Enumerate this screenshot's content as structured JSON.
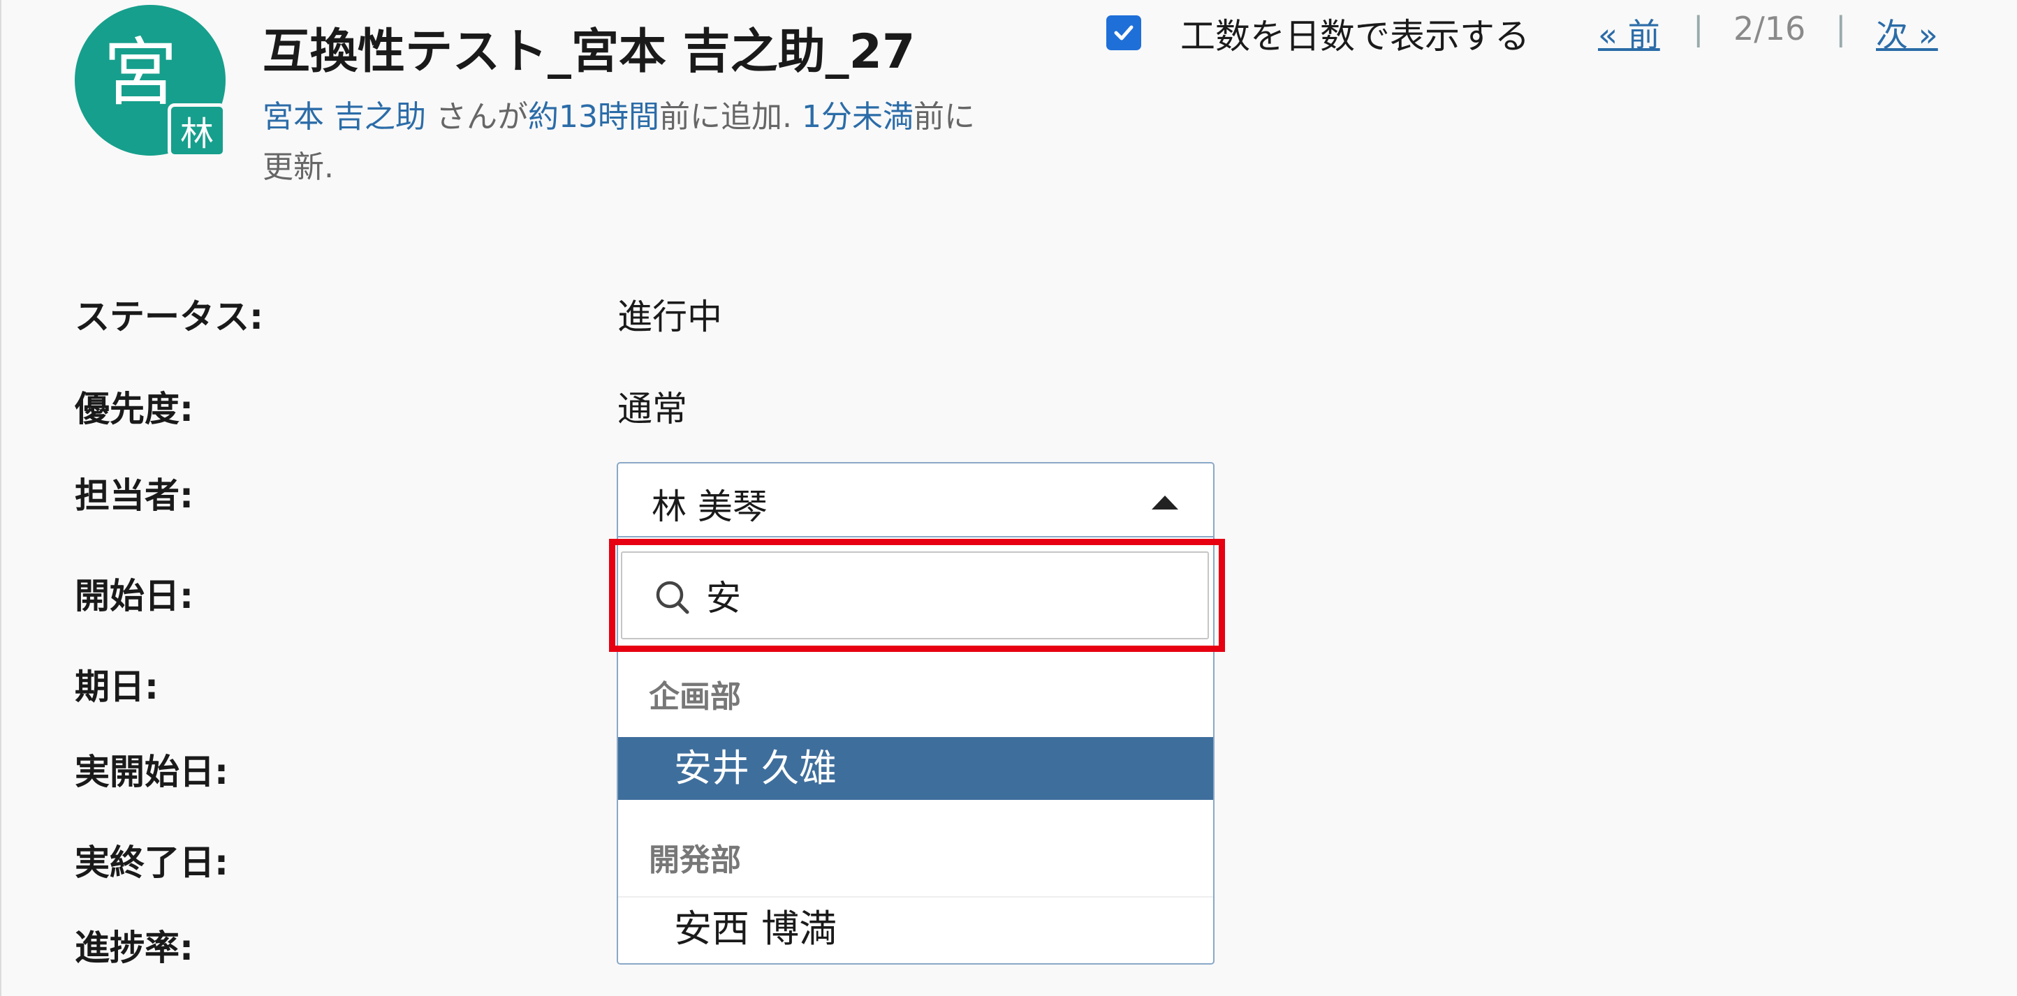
{
  "header": {
    "avatar_char": "宮",
    "avatar_badge": "林",
    "title": "互換性テスト_宮本 吉之助_27",
    "author_link": "宮本 吉之助",
    "text_san_ga": " さんが",
    "added_link": "約13時間",
    "text_added": "前に追加. ",
    "updated_link": "1分未満",
    "text_updated_a": "前に",
    "text_updated_b": "更新."
  },
  "options_bar": {
    "show_days_checked": true,
    "show_days_label": "工数を日数で表示する",
    "prev_label": "« 前",
    "sep": "|",
    "position": "2/16",
    "next_label": "次 »"
  },
  "attributes": {
    "status_label": "ステータス:",
    "status_value": "進行中",
    "priority_label": "優先度:",
    "priority_value": "通常",
    "assignee_label": "担当者:",
    "start_label": "開始日:",
    "due_label": "期日:",
    "actual_start_label": "実開始日:",
    "actual_end_label": "実終了日:",
    "progress_label": "進捗率:"
  },
  "assignee_select": {
    "selected_value": "林 美琴",
    "search_value": "安",
    "groups": [
      {
        "name": "企画部",
        "options": [
          "安井 久雄"
        ]
      },
      {
        "name": "開発部",
        "options": [
          "安西 博満"
        ]
      }
    ],
    "highlighted_option": "安井 久雄"
  },
  "colors": {
    "accent_link": "#2b6ca8",
    "avatar_bg": "#169f8c",
    "option_highlight": "#3e6e9c",
    "annotation_red": "#e60012"
  }
}
